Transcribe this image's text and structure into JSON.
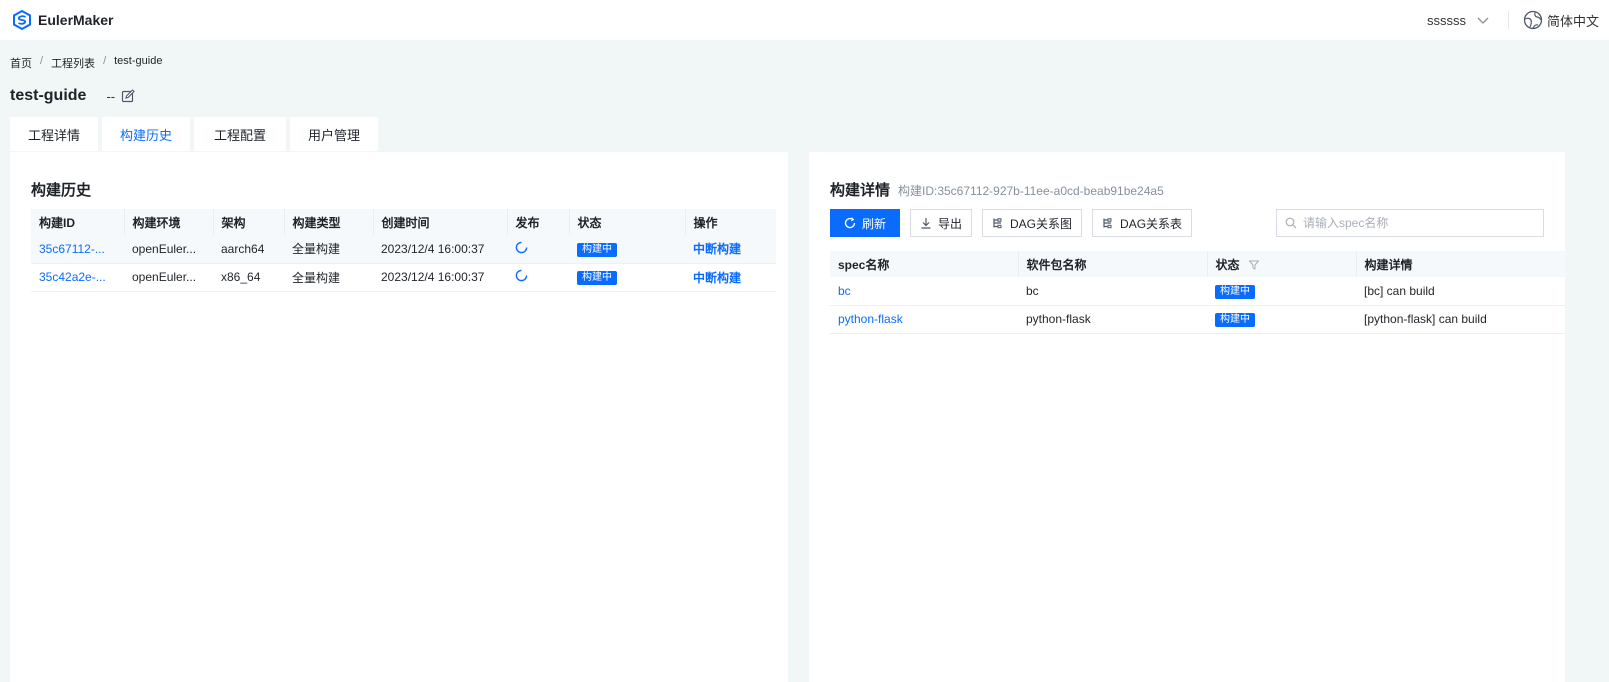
{
  "app": {
    "name": "EulerMaker"
  },
  "header": {
    "username": "ssssss",
    "language": "简体中文"
  },
  "breadcrumb": [
    "首页",
    "工程列表",
    "test-guide"
  ],
  "project": {
    "name": "test-guide",
    "description": "--"
  },
  "tabs": [
    {
      "label": "工程详情",
      "active": false
    },
    {
      "label": "构建历史",
      "active": true
    },
    {
      "label": "工程配置",
      "active": false
    },
    {
      "label": "用户管理",
      "active": false
    }
  ],
  "history": {
    "title": "构建历史",
    "columns": [
      "构建ID",
      "构建环境",
      "架构",
      "构建类型",
      "创建时间",
      "发布",
      "状态",
      "操作"
    ],
    "rows": [
      {
        "id": "35c67112-...",
        "env": "openEuler...",
        "arch": "aarch64",
        "type": "全量构建",
        "time": "2023/12/4 16:00:37",
        "status": "构建中",
        "action": "中断构建"
      },
      {
        "id": "35c42a2e-...",
        "env": "openEuler...",
        "arch": "x86_64",
        "type": "全量构建",
        "time": "2023/12/4 16:00:37",
        "status": "构建中",
        "action": "中断构建"
      }
    ]
  },
  "detail": {
    "title": "构建详情",
    "build_id_label": "构建ID:35c67112-927b-11ee-a0cd-beab91be24a5",
    "toolbar": {
      "refresh": "刷新",
      "export": "导出",
      "dag_graph": "DAG关系图",
      "dag_table": "DAG关系表"
    },
    "search": {
      "placeholder": "请输入spec名称",
      "value": ""
    },
    "columns": [
      "spec名称",
      "软件包名称",
      "状态",
      "构建详情"
    ],
    "rows": [
      {
        "spec": "bc",
        "package": "bc",
        "status": "构建中",
        "detail": "[bc] can build"
      },
      {
        "spec": "python-flask",
        "package": "python-flask",
        "status": "构建中",
        "detail": "[python-flask] can build"
      }
    ]
  },
  "colors": {
    "accent": "#0a6cff",
    "background": "#f0f7f6"
  },
  "icons": [
    "eulermaker-logo-icon",
    "chevron-down-icon",
    "globe-icon",
    "edit-icon",
    "spinner-icon",
    "refresh-icon",
    "download-icon",
    "dag-icon",
    "search-icon",
    "filter-icon"
  ]
}
